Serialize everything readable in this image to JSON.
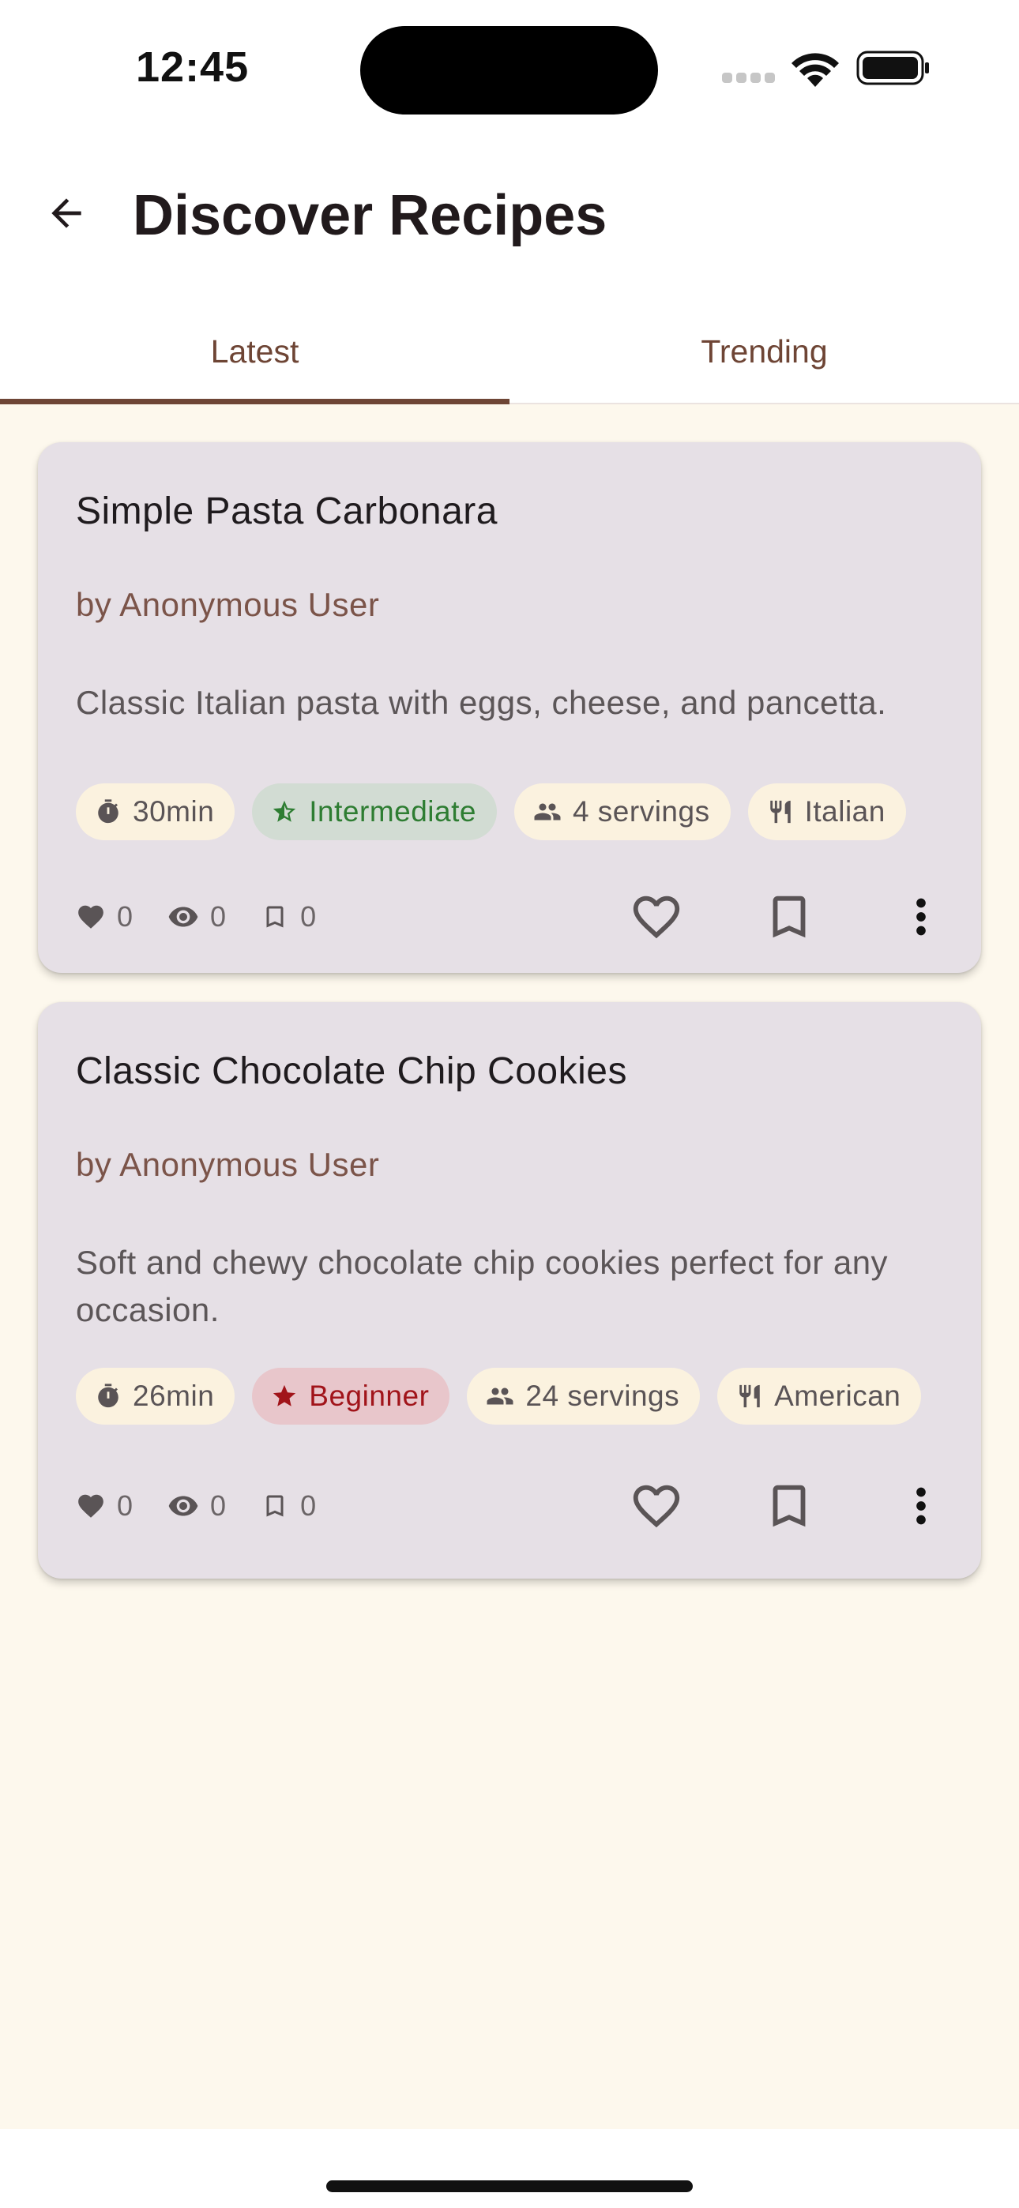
{
  "status_bar": {
    "time": "12:45",
    "icons": [
      "signal-icon",
      "wifi-icon",
      "battery-icon"
    ]
  },
  "app_bar": {
    "back_icon": "arrow-back-icon",
    "title": "Discover Recipes"
  },
  "tabs": [
    {
      "label": "Latest",
      "selected": true
    },
    {
      "label": "Trending",
      "selected": false
    }
  ],
  "recipes": [
    {
      "title": "Simple Pasta Carbonara",
      "author": "by Anonymous User",
      "description": "Classic Italian pasta with eggs, cheese, and pancetta.",
      "chips": {
        "time": "30min",
        "difficulty": "Intermediate",
        "servings": "4 servings",
        "cuisine": "Italian"
      },
      "stats": {
        "likes": "0",
        "views": "0",
        "bookmarks": "0"
      }
    },
    {
      "title": "Classic Chocolate Chip Cookies",
      "author": "by Anonymous User",
      "description": "Soft and chewy chocolate chip cookies perfect for any occasion.",
      "chips": {
        "time": "26min",
        "difficulty": "Beginner",
        "servings": "24 servings",
        "cuisine": "American"
      },
      "stats": {
        "likes": "0",
        "views": "0",
        "bookmarks": "0"
      }
    }
  ],
  "colors": {
    "accent": "#6e4535",
    "background": "#fdf8ed",
    "card": "#e6e0e6",
    "chip": "#fbf2df",
    "intermediate_chip": "#d2dcd3",
    "intermediate_text": "#2e7d32",
    "beginner_chip": "#e8c6cb",
    "beginner_text": "#a1141a"
  }
}
